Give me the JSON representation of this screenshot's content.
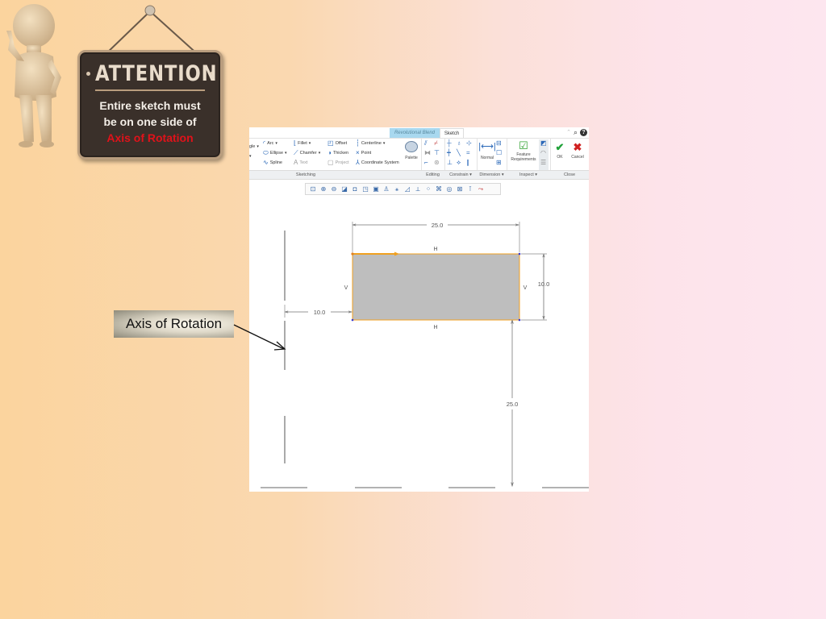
{
  "slide": {
    "background_colors": [
      "#fbd49e",
      "#fde6ef"
    ],
    "attention_sign": {
      "title": "ATTENTION",
      "line1": "Entire sketch must",
      "line2": "be on one side of",
      "highlight": "Axis of Rotation",
      "highlight_color": "#e0121a"
    },
    "callout": {
      "label": "Axis of Rotation"
    }
  },
  "app": {
    "tabs": [
      {
        "label": "Revolutional Blend"
      },
      {
        "label": "Sketch"
      }
    ],
    "top_icons": {
      "search": "⌕",
      "help": "?"
    },
    "ribbon": {
      "sketching": {
        "tools": [
          {
            "label": "Arc",
            "icon": "arc-icon",
            "glyph": "◜",
            "dropdown": true
          },
          {
            "label": "Ellipse",
            "icon": "ellipse-icon",
            "glyph": "⬭",
            "dropdown": true
          },
          {
            "label": "Spline",
            "icon": "spline-icon",
            "glyph": "∿",
            "dropdown": false
          },
          {
            "label": "Fillet",
            "icon": "fillet-icon",
            "glyph": "⌊",
            "dropdown": true
          },
          {
            "label": "Chamfer",
            "icon": "chamfer-icon",
            "glyph": "⟋",
            "dropdown": true
          },
          {
            "label": "Text",
            "icon": "text-icon",
            "glyph": "A",
            "dropdown": false
          },
          {
            "label": "Offset",
            "icon": "offset-icon",
            "glyph": "◰",
            "dropdown": false
          },
          {
            "label": "Thicken",
            "icon": "thicken-icon",
            "glyph": "◑",
            "dropdown": false
          },
          {
            "label": "Project",
            "icon": "project-icon",
            "glyph": "▢",
            "dropdown": false
          },
          {
            "label": "Centerline",
            "icon": "centerline-icon",
            "glyph": "┆",
            "dropdown": true
          },
          {
            "label": "Point",
            "icon": "point-icon",
            "glyph": "×",
            "dropdown": false
          },
          {
            "label": "Coordinate System",
            "icon": "coordinate-system-icon",
            "glyph": "⅄",
            "dropdown": false
          },
          {
            "label": "Palette",
            "icon": "palette-icon",
            "glyph": "⬮",
            "dropdown": false
          }
        ],
        "left_cut_labels": [
          "gle",
          "",
          ""
        ],
        "group_label": "Sketching"
      },
      "editing": {
        "group_label": "Editing",
        "dropdown": false
      },
      "constrain": {
        "group_label": "Constrain",
        "dropdown": true
      },
      "dimension": {
        "group_label": "Dimension",
        "normal_label": "Normal",
        "dropdown": true
      },
      "inspect": {
        "group_label": "Inspect",
        "feature_req_line1": "Feature",
        "feature_req_line2": "Requirements",
        "dropdown": true
      },
      "close": {
        "group_label": "Close",
        "ok_label": "OK",
        "cancel_label": "Cancel"
      }
    },
    "graphics_toolbar_count": 17,
    "sketch": {
      "dimensions": {
        "width": "25.0",
        "height": "10.0",
        "offset_from_axis": "10.0",
        "vertical_offset": "25.0"
      },
      "constraint_labels": {
        "top": "H",
        "bottom": "H",
        "left": "V",
        "right": "V"
      },
      "colors": {
        "fill": "#bebebe",
        "edge": "#f0a020",
        "dimension": "#707070"
      }
    }
  }
}
